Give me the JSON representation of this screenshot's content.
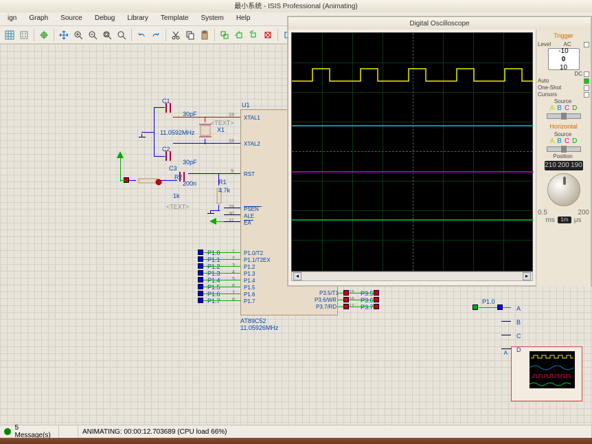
{
  "window": {
    "title": "最小系统 - ISIS Professional (Animating)"
  },
  "menu": [
    "ign",
    "Graph",
    "Source",
    "Debug",
    "Library",
    "Template",
    "System",
    "Help"
  ],
  "scope": {
    "title": "Digital Oscilloscope",
    "trigger_title": "Trigger",
    "level_label": "Level",
    "ac_label": "AC",
    "dc_label": "DC",
    "level_vals": [
      "-10",
      "0",
      "10"
    ],
    "auto_label": "Auto",
    "oneshot_label": "One-Shot",
    "cursors_label": "Cursors",
    "source_label": "Source",
    "sources": [
      "A",
      "B",
      "C",
      "D"
    ],
    "horizontal_title": "Horizontal",
    "position_label": "Position",
    "pos_vals": [
      "210",
      "200",
      "190"
    ],
    "scale_tick_min": "0.5",
    "scale_tick_max": "200",
    "unit_ms": "ms",
    "unit_div": "1m",
    "unit_us": "μs"
  },
  "schematic": {
    "c1": "C1",
    "c1_val": "30pF",
    "c2": "C2",
    "c2_val": "30pF",
    "c3": "C3",
    "c3_val": "200n",
    "x1": "X1",
    "x1_val": "11.0592MHz",
    "r1": "R1",
    "r1_val": "4.7k",
    "r2": "R2",
    "r3": "1k",
    "u1": "U1",
    "u1_part": "AT89C52",
    "u1_freq": "11.05926MHz",
    "text_ph": "<TEXT>",
    "pins_left": [
      {
        "n": "19",
        "l": "XTAL1"
      },
      {
        "n": "18",
        "l": "XTAL2"
      },
      {
        "n": "9",
        "l": "RST"
      },
      {
        "n": "29",
        "l": "PSEN"
      },
      {
        "n": "30",
        "l": "ALE"
      },
      {
        "n": "31",
        "l": "EA"
      }
    ],
    "p1_rows": [
      {
        "pf": "P1.0",
        "n": "1",
        "l": "P1.0/T2"
      },
      {
        "pf": "P1.1",
        "n": "2",
        "l": "P1.1/T2EX"
      },
      {
        "pf": "P1.2",
        "n": "3",
        "l": "P1.2"
      },
      {
        "pf": "P1.3",
        "n": "4",
        "l": "P1.3"
      },
      {
        "pf": "P1.4",
        "n": "5",
        "l": "P1.4"
      },
      {
        "pf": "P1.5",
        "n": "6",
        "l": "P1.5"
      },
      {
        "pf": "P1.6",
        "n": "7",
        "l": "P1.6"
      },
      {
        "pf": "P1.7",
        "n": "8",
        "l": "P1.7"
      }
    ],
    "p3_rows": [
      {
        "l": "P3.5/T1",
        "n": "15",
        "r": "P3.5"
      },
      {
        "l": "P3.6/WR",
        "n": "16",
        "r": "P3.6"
      },
      {
        "l": "P3.7/RD",
        "n": "17",
        "r": "P3.7"
      }
    ],
    "scope_instr": {
      "a": "A",
      "b": "B",
      "c": "C",
      "d": "D",
      "net": "P1.0"
    }
  },
  "status": {
    "messages": "5 Message(s)",
    "anim": "ANIMATING: 00:00:12.703689 (CPU load 66%)"
  }
}
